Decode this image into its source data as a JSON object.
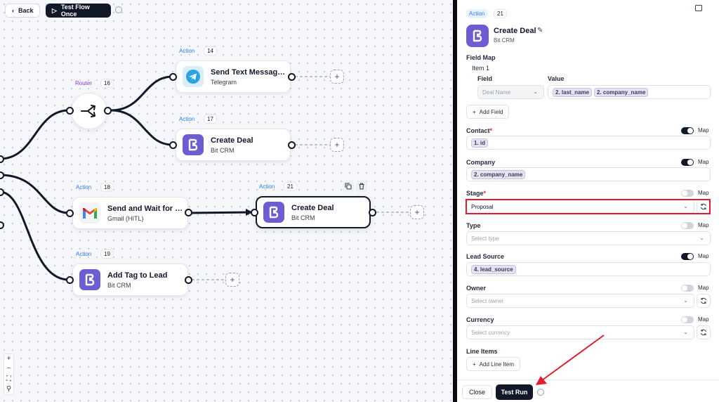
{
  "toolbar": {
    "back_label": "Back",
    "test_flow_label": "Test Flow Once"
  },
  "canvas": {
    "router": {
      "badge": "Router",
      "number": "16"
    },
    "nodes": [
      {
        "badge": "Action",
        "number": "14",
        "title": "Send Text Message ...",
        "subtitle": "Telegram",
        "icon": "telegram-icon"
      },
      {
        "badge": "Action",
        "number": "17",
        "title": "Create Deal",
        "subtitle": "Bit CRM",
        "icon": "bit-crm-icon"
      },
      {
        "badge": "Action",
        "number": "18",
        "title": "Send and Wait for R...",
        "subtitle": "Gmail (HITL)",
        "icon": "gmail-icon"
      },
      {
        "badge": "Action",
        "number": "21",
        "title": "Create Deal",
        "subtitle": "Bit CRM",
        "icon": "bit-crm-icon"
      },
      {
        "badge": "Action",
        "number": "19",
        "title": "Add Tag to Lead",
        "subtitle": "Bit CRM",
        "icon": "bit-crm-icon"
      }
    ],
    "zoom_controls": [
      "+",
      "−",
      "⛶",
      "⚲"
    ]
  },
  "panel": {
    "badge": "Action",
    "number": "21",
    "title": "Create Deal",
    "subtitle": "Bit CRM",
    "field_map": {
      "label": "Field Map",
      "item_label": "Item 1",
      "col_field": "Field",
      "col_value": "Value",
      "field_value": "Deal Name",
      "value_chips": [
        "2. last_name",
        "2. company_name"
      ],
      "add_field": "Add Field"
    },
    "contact": {
      "label": "Contact",
      "required": "*",
      "chips": [
        "1. id"
      ],
      "map": "Map",
      "map_on": true
    },
    "company": {
      "label": "Company",
      "chips": [
        "2. company_name"
      ],
      "map": "Map",
      "map_on": true
    },
    "stage": {
      "label": "Stage",
      "required": "*",
      "value": "Proposal",
      "map": "Map",
      "map_on": false
    },
    "type": {
      "label": "Type",
      "placeholder": "Select type",
      "map": "Map",
      "map_on": false
    },
    "lead_source": {
      "label": "Lead Source",
      "chips": [
        "4. lead_source"
      ],
      "map": "Map",
      "map_on": true
    },
    "owner": {
      "label": "Owner",
      "placeholder": "Select owner",
      "map": "Map",
      "map_on": false
    },
    "currency": {
      "label": "Currency",
      "placeholder": "Select currency",
      "map": "Map",
      "map_on": false
    },
    "line_items": {
      "label": "Line Items",
      "add_label": "Add Line Item"
    },
    "footer": {
      "close_label": "Close",
      "run_label": "Test Run"
    }
  },
  "colors": {
    "bit_crm": "#6d5dd3",
    "accent_action": "#2e7cf6",
    "router": "#9333ea",
    "highlight": "#e11d2f",
    "dark": "#111827"
  }
}
